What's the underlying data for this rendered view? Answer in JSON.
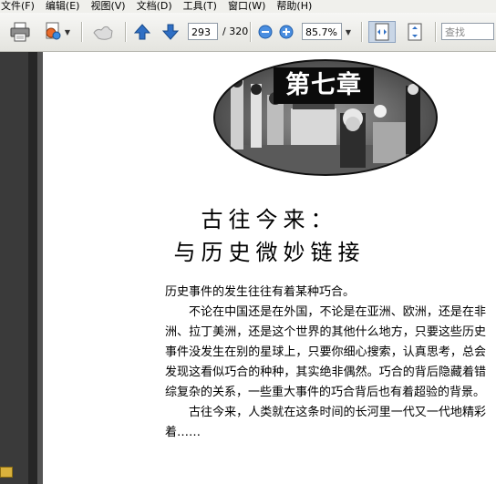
{
  "menu": [
    "文件(F)",
    "编辑(E)",
    "视图(V)",
    "文档(D)",
    "工具(T)",
    "窗口(W)",
    "帮助(H)"
  ],
  "toolbar": {
    "current_page": "293",
    "total_pages": "/ 320",
    "zoom": "85.7%",
    "search_placeholder": "查找"
  },
  "page": {
    "chapter_label": "第七章",
    "title_line1": "古往今来：",
    "title_line2": "与历史微妙链接",
    "paragraphs": [
      "历史事件的发生往往有着某种巧合。",
      "不论在中国还是在外国，不论是在亚洲、欧洲，还是在非洲、拉丁美洲，还是这个世界的其他什么地方，只要这些历史事件没发生在别的星球上，只要你细心搜索，认真思考，总会发现这看似巧合的种种，其实绝非偶然。巧合的背后隐藏着错综复杂的关系，一些重大事件的巧合背后也有着超验的背景。",
      "古往今来，人类就在这条时间的长河里一代又一代地精彩着……"
    ]
  },
  "colors": {
    "nav_panel": "#3a3a3a",
    "toolbar": "#e9e9e5",
    "arrow_blue": "#2f6fc4"
  }
}
